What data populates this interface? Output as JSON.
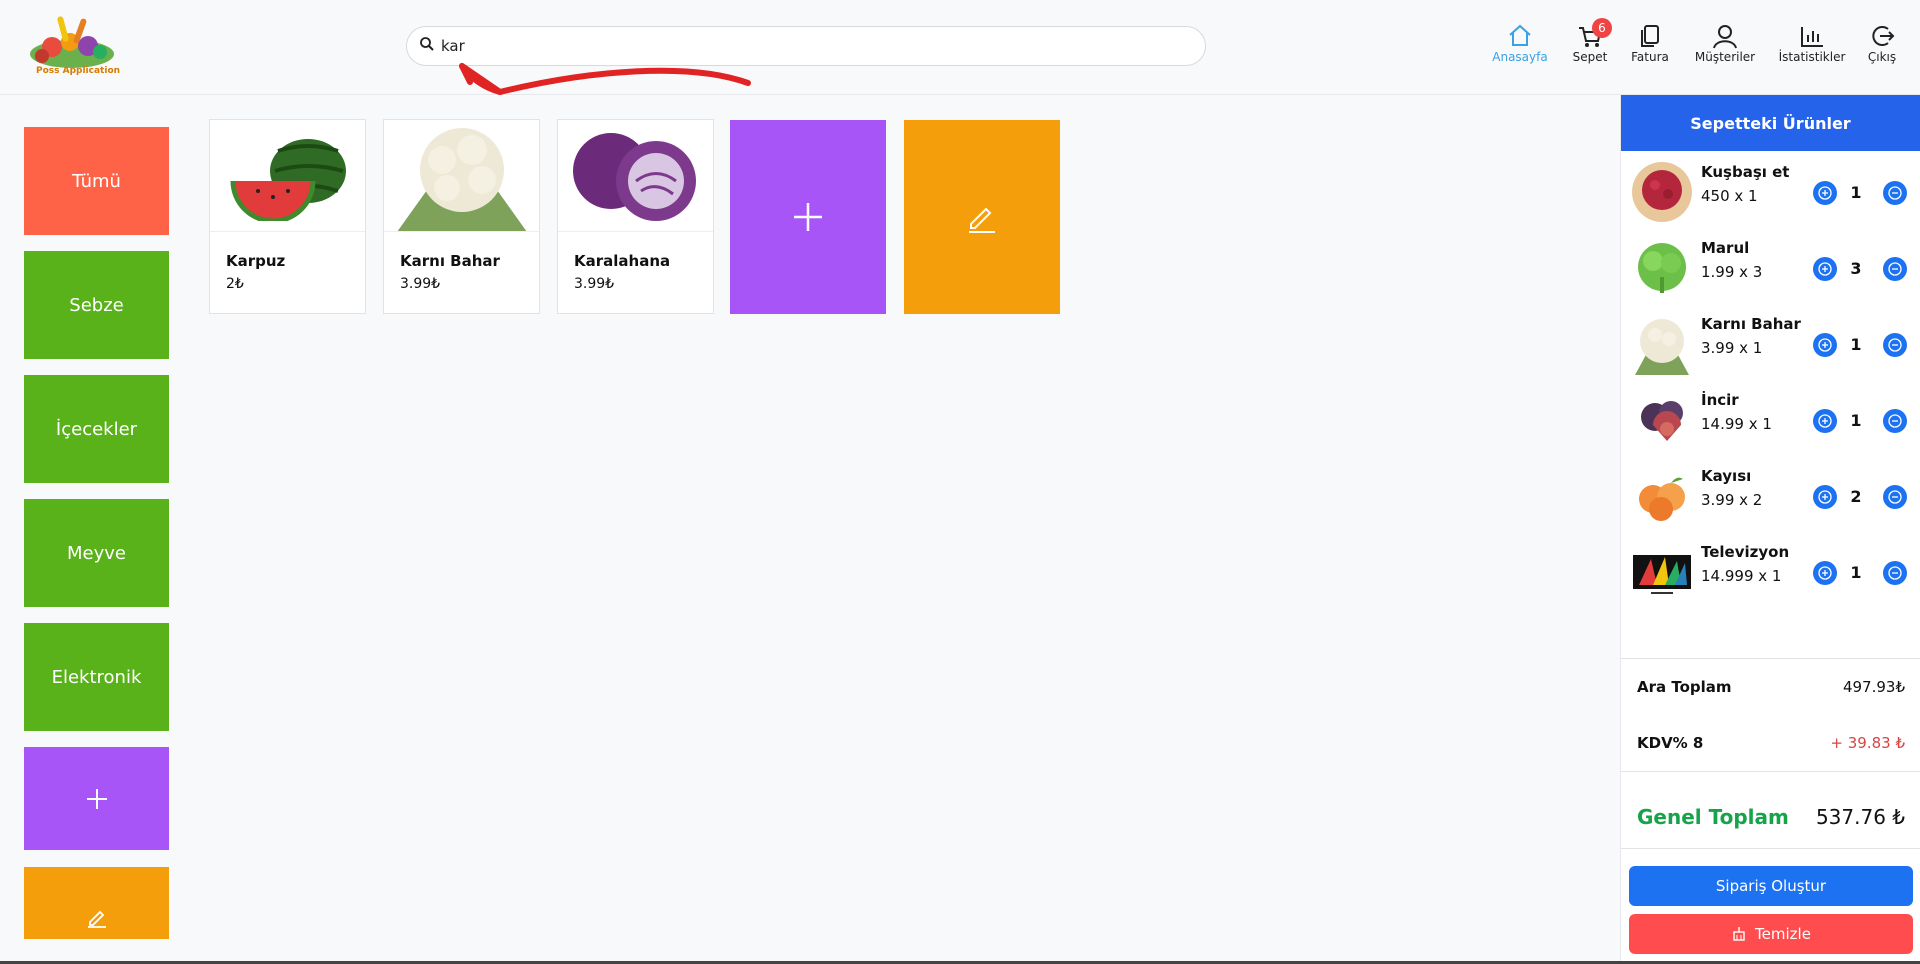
{
  "header": {
    "logo_text": "Poss Application",
    "search": {
      "value": "kar",
      "placeholder": ""
    },
    "nav": [
      {
        "label": "Anasayfa"
      },
      {
        "label": "Sepet",
        "badge": "6"
      },
      {
        "label": "Fatura"
      },
      {
        "label": "Müşteriler"
      },
      {
        "label": "İstatistikler"
      },
      {
        "label": "Çıkış"
      }
    ]
  },
  "categories": [
    "Tümü",
    "Sebze",
    "İçecekler",
    "Meyve",
    "Elektronik"
  ],
  "colors": {
    "all": "#ff6347",
    "category": "#5ab21b",
    "add": "#a855f7",
    "edit": "#f59e0b",
    "primary": "#2563eb",
    "danger": "#ef4444",
    "total": "#16a34a"
  },
  "products": [
    {
      "name": "Karpuz",
      "price": "2₺"
    },
    {
      "name": "Karnı Bahar",
      "price": "3.99₺"
    },
    {
      "name": "Karalahana",
      "price": "3.99₺"
    }
  ],
  "cart": {
    "title": "Sepetteki Ürünler",
    "items": [
      {
        "name": "Kuşbaşı et",
        "sub": "450 x 1",
        "qty": "1"
      },
      {
        "name": "Marul",
        "sub": "1.99 x 3",
        "qty": "3"
      },
      {
        "name": "Karnı Bahar",
        "sub": "3.99 x 1",
        "qty": "1"
      },
      {
        "name": "İncir",
        "sub": "14.99 x 1",
        "qty": "1"
      },
      {
        "name": "Kayısı",
        "sub": "3.99 x 2",
        "qty": "2"
      },
      {
        "name": "Televizyon",
        "sub": "14.999 x 1",
        "qty": "1"
      }
    ],
    "subtotal_label": "Ara Toplam",
    "subtotal_value": "497.93₺",
    "tax_label": "KDV% 8",
    "tax_value": "+ 39.83 ₺",
    "total_label": "Genel Toplam",
    "total_value": "537.76 ₺",
    "order_button": "Sipariş Oluştur",
    "clear_button": "Temizle"
  }
}
